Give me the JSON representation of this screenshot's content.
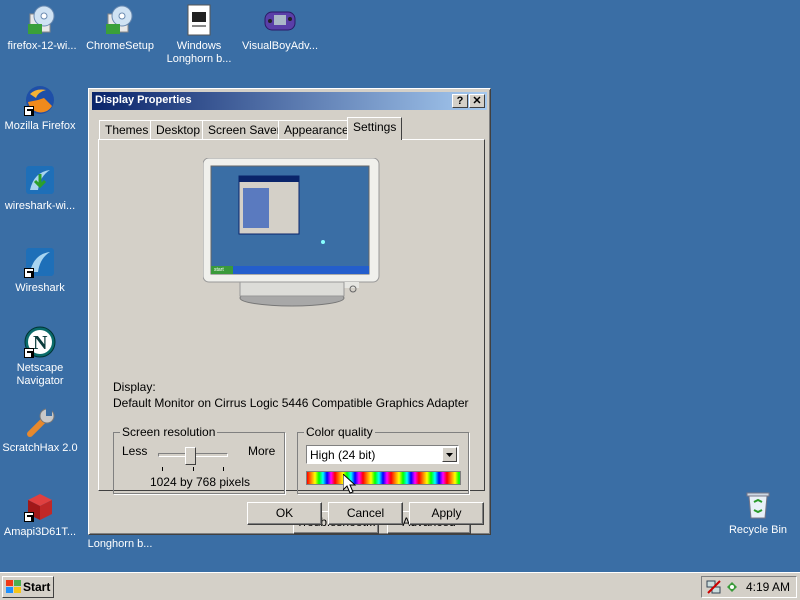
{
  "desktop": {
    "icons": [
      {
        "label": "firefox-12-wi...",
        "icon": "installer-disc-icon"
      },
      {
        "label": "ChromeSetup",
        "icon": "installer-disc-icon"
      },
      {
        "label": "Windows Longhorn b...",
        "icon": "document-window-icon"
      },
      {
        "label": "VisualBoyAdv...",
        "icon": "gameboy-advance-icon"
      },
      {
        "label": "Mozilla Firefox",
        "icon": "firefox-icon"
      },
      {
        "label": "wireshark-wi...",
        "icon": "wireshark-installer-icon"
      },
      {
        "label": "Wireshark",
        "icon": "wireshark-icon"
      },
      {
        "label": "Netscape Navigator",
        "icon": "netscape-icon"
      },
      {
        "label": "ScratchHax 2.0",
        "icon": "wrench-icon"
      },
      {
        "label": "Amapi3D61T...",
        "icon": "3d-box-icon"
      },
      {
        "label": "Recycle Bin",
        "icon": "recycle-bin-icon"
      }
    ],
    "partial_label": "Longhorn b..."
  },
  "window": {
    "title": "Display Properties",
    "help_btn": "?",
    "close_btn": "✕",
    "tabs": [
      "Themes",
      "Desktop",
      "Screen Saver",
      "Appearance",
      "Settings"
    ],
    "active_tab": "Settings",
    "display_label": "Display:",
    "display_value": "Default Monitor on Cirrus Logic 5446 Compatible Graphics Adapter",
    "resolution": {
      "title": "Screen resolution",
      "less": "Less",
      "more": "More",
      "value_text": "1024 by 768 pixels",
      "slider_fraction": 0.45
    },
    "color_quality": {
      "title": "Color quality",
      "selected": "High (24 bit)"
    },
    "buttons": {
      "troubleshoot": "Troubleshoot...",
      "advanced": "Advanced",
      "ok": "OK",
      "cancel": "Cancel",
      "apply": "Apply"
    },
    "preview": {
      "start_label": "start"
    }
  },
  "taskbar": {
    "start_label": "Start",
    "clock": "4:19 AM"
  },
  "colors": {
    "desktop_bg": "#3a6ea5",
    "title_active_start": "#0a246a",
    "title_active_end": "#a6caf0"
  }
}
